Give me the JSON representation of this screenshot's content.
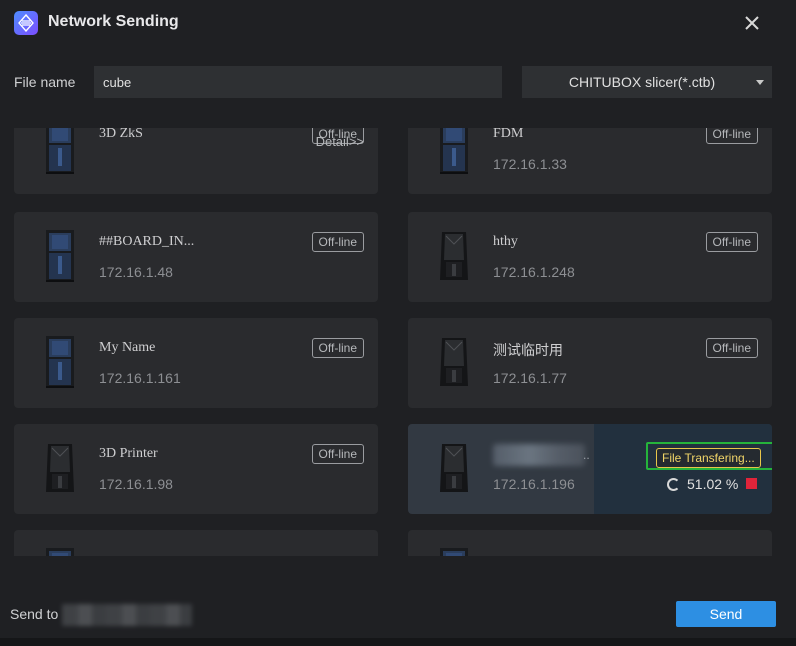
{
  "window": {
    "title": "Network Sending"
  },
  "file": {
    "label": "File name",
    "value": "cube",
    "format": "CHITUBOX slicer(*.ctb)"
  },
  "printers": [
    {
      "name": "3D ZkS",
      "ip": "",
      "status": "Off-line",
      "detail": "Detail>>",
      "thumb": "blue"
    },
    {
      "name": "FDM",
      "ip": "172.16.1.33",
      "status": "Off-line",
      "thumb": "blue"
    },
    {
      "name": "##BOARD_IN...",
      "ip": "172.16.1.48",
      "status": "Off-line",
      "thumb": "blue"
    },
    {
      "name": "hthy",
      "ip": "172.16.1.248",
      "status": "Off-line",
      "thumb": "dark"
    },
    {
      "name": "My Name",
      "ip": "172.16.1.161",
      "status": "Off-line",
      "thumb": "blue"
    },
    {
      "name": "测试临时用",
      "ip": "172.16.1.77",
      "status": "Off-line",
      "thumb": "dark"
    },
    {
      "name": "3D Printer",
      "ip": "172.16.1.98",
      "status": "Off-line",
      "thumb": "dark"
    },
    {
      "name": "",
      "ip": "172.16.1.196",
      "status": "File Transfering...",
      "progress_text": "51.02 %",
      "progress": 51.02,
      "active": true,
      "thumb": "dark"
    }
  ],
  "footer": {
    "send_to_label": "Send to",
    "send_button": "Send"
  },
  "colors": {
    "accent": "#2d8fe3",
    "highlight": "#25b33b",
    "transfer": "#f0d468",
    "stop": "#e0243a"
  }
}
